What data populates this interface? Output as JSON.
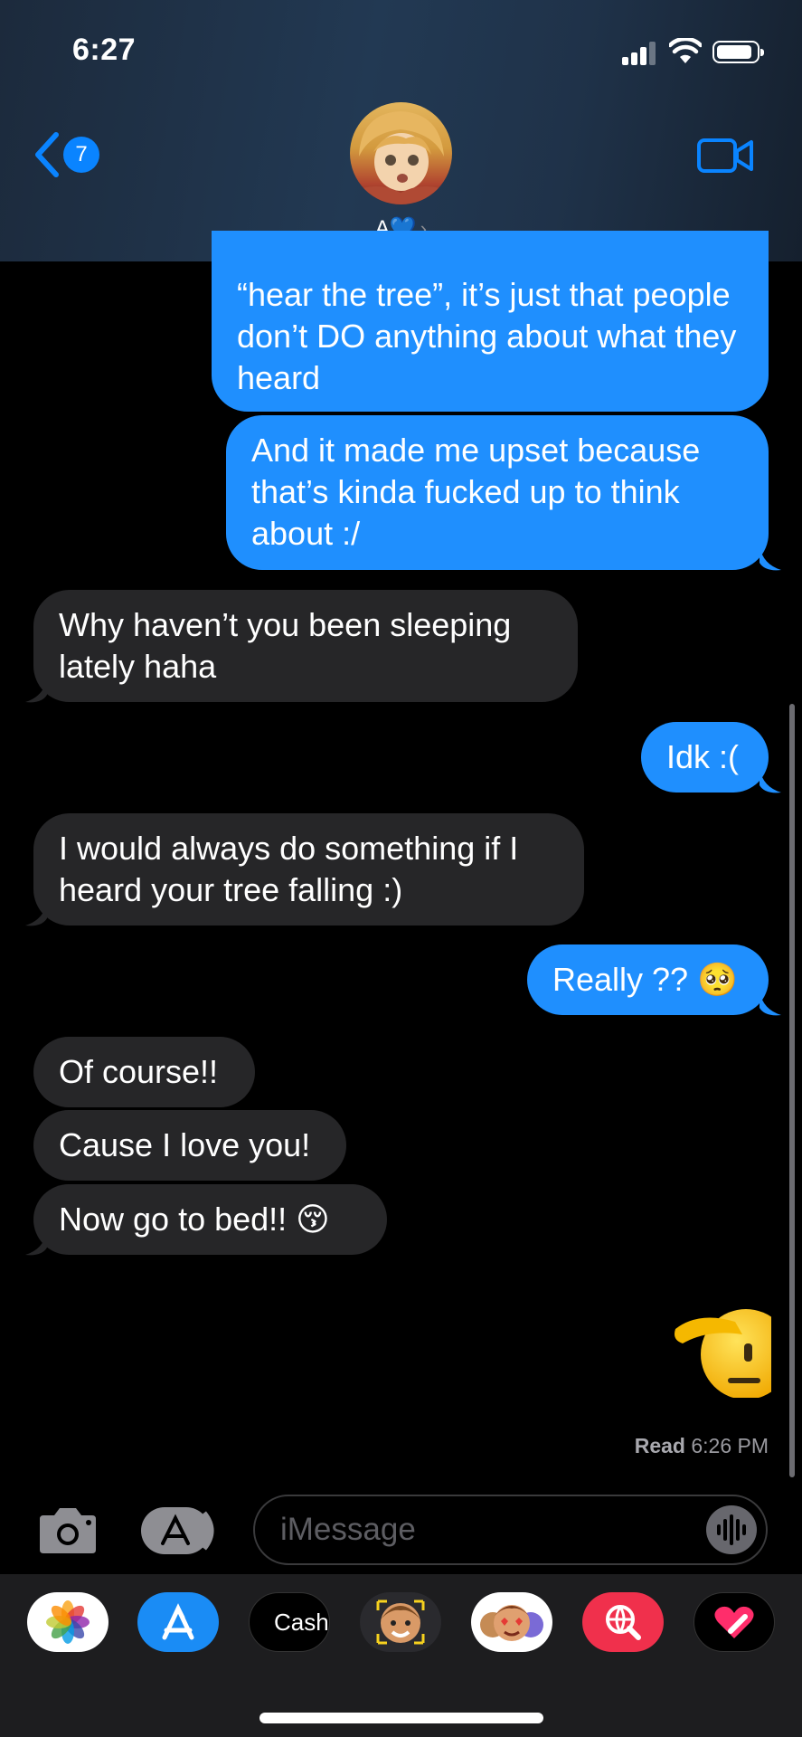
{
  "status": {
    "time": "6:27"
  },
  "nav": {
    "back_badge": "7",
    "contact_name": "A💙"
  },
  "messages": [
    {
      "from": "me",
      "text": "“hear the tree”, it’s just that people don’t DO anything about what they heard"
    },
    {
      "from": "me",
      "text": "And it made me upset because that’s kinda fucked up to think about :/"
    },
    {
      "from": "them",
      "text": "Why haven’t you been sleeping lately haha"
    },
    {
      "from": "me",
      "text": "Idk :("
    },
    {
      "from": "them",
      "text": "I would always do something if I heard your tree falling :)"
    },
    {
      "from": "me",
      "text": "Really ?? 🥺"
    },
    {
      "from": "them",
      "text": "Of course!!"
    },
    {
      "from": "them",
      "text": "Cause I love you!"
    },
    {
      "from": "them",
      "text": "Now go to bed!! 😚"
    },
    {
      "from": "me",
      "text": "🫡"
    }
  ],
  "receipt": {
    "label": "Read",
    "time": "6:26 PM"
  },
  "compose": {
    "placeholder": "iMessage"
  },
  "tray": {
    "apps": [
      {
        "name": "photos-app-icon"
      },
      {
        "name": "app-store-app-icon"
      },
      {
        "name": "apple-cash-app-icon",
        "label": "Cash"
      },
      {
        "name": "memoji-app-icon"
      },
      {
        "name": "memoji-stickers-app-icon"
      },
      {
        "name": "web-search-app-icon"
      },
      {
        "name": "digital-touch-app-icon"
      }
    ]
  },
  "colors": {
    "sent_bubble": "#1f8ffe",
    "received_bubble": "#262628",
    "accent": "#0a84ff"
  }
}
